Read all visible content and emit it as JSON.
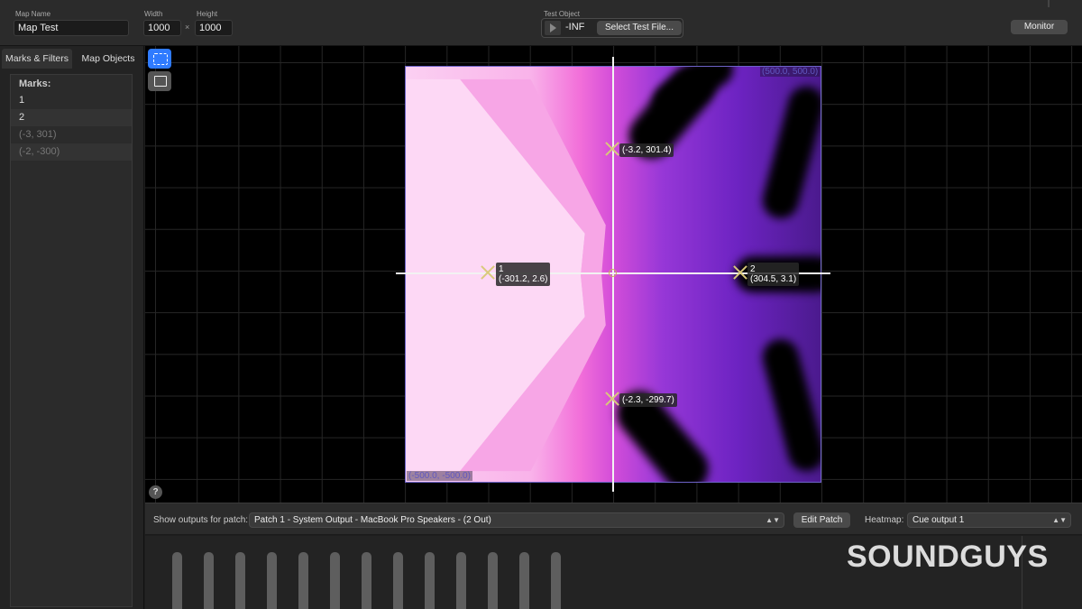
{
  "toolbar": {
    "map_name_label": "Map Name",
    "map_name_value": "Map Test",
    "width_label": "Width",
    "width_value": "1000",
    "height_label": "Height",
    "height_value": "1000",
    "times_symbol": "×",
    "test_object_label": "Test Object",
    "level_value": "-INF",
    "select_test_file_label": "Select Test File...",
    "monitor_label": "Monitor"
  },
  "sidebar": {
    "tabs": [
      {
        "label": "Marks & Filters",
        "active": true
      },
      {
        "label": "Map Objects",
        "active": false
      }
    ],
    "marks_header": "Marks:",
    "marks": [
      {
        "label": "1"
      },
      {
        "label": "2"
      },
      {
        "label": "(-3, 301)"
      },
      {
        "label": "(-2, -300)"
      }
    ]
  },
  "canvas": {
    "corner_top_right": "(500.0, 500.0)",
    "corner_bottom_left": "(-500.0, -500.0)",
    "help_label": "?",
    "marks": [
      {
        "name": "1",
        "coords": "(-301.2, 2.6)"
      },
      {
        "name": "2",
        "coords": "(304.5, 3.1)"
      },
      {
        "name": "",
        "coords": "(-3.2, 301.4)"
      },
      {
        "name": "",
        "coords": "(-2.3, -299.7)"
      }
    ]
  },
  "patchbar": {
    "show_outputs_label": "Show outputs for patch:",
    "patch_value": "Patch 1 - System Output - MacBook Pro Speakers - (2 Out)",
    "edit_patch_label": "Edit Patch",
    "heatmap_label": "Heatmap:",
    "heatmap_value": "Cue output 1"
  },
  "watermark": "SOUNDGUYS",
  "colors": {
    "accent": "#2f7bff",
    "heatmap_light": "#fbd0f2",
    "heatmap_mid": "#f26fd9",
    "heatmap_dark": "#4b1a8e",
    "mark": "#d9c97a"
  }
}
